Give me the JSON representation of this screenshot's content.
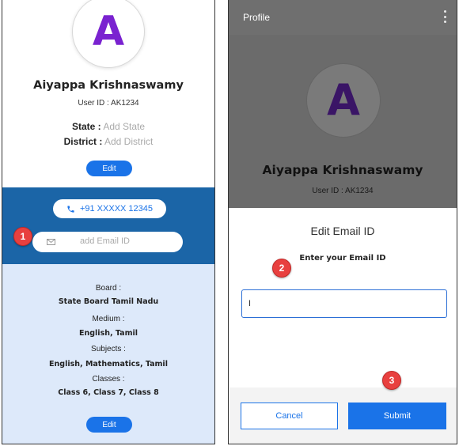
{
  "colors": {
    "accent": "#1a73e8",
    "avatar_letter": "#7a22d0",
    "contact_band": "#1b65a7",
    "info_panel": "#dde9fa",
    "step_badge": "#e8403f",
    "dim_overlay": "#6b6b6b"
  },
  "left": {
    "avatar_letter": "A",
    "name": "Aiyappa Krishnaswamy",
    "user_id": "User ID : AK1234",
    "state_label": "State :",
    "state_value": "Add State",
    "district_label": "District :",
    "district_value": "Add District",
    "edit_label": "Edit",
    "phone_icon": "phone-icon",
    "phone": "+91 XXXXX 12345",
    "mail_icon": "mail-icon",
    "email_placeholder": "add Email ID",
    "step_badge": "1",
    "info": {
      "board_label": "Board :",
      "board_value": "State Board Tamil Nadu",
      "medium_label": "Medium :",
      "medium_value": "English, Tamil",
      "subjects_label": "Subjects :",
      "subjects_value": "English, Mathematics, Tamil",
      "classes_label": "Classes :",
      "classes_value": "Class 6, Class 7, Class 8",
      "edit_label": "Edit"
    }
  },
  "right": {
    "topbar_title": "Profile",
    "menu_icon": "more-vertical-icon",
    "avatar_letter": "A",
    "name": "Aiyappa Krishnaswamy",
    "user_id": "User ID : AK1234",
    "dialog": {
      "title": "Edit Email ID",
      "subtitle": "Enter your Email ID",
      "input_value": "I",
      "cancel_label": "Cancel",
      "submit_label": "Submit"
    },
    "step_badge_2": "2",
    "step_badge_3": "3"
  }
}
